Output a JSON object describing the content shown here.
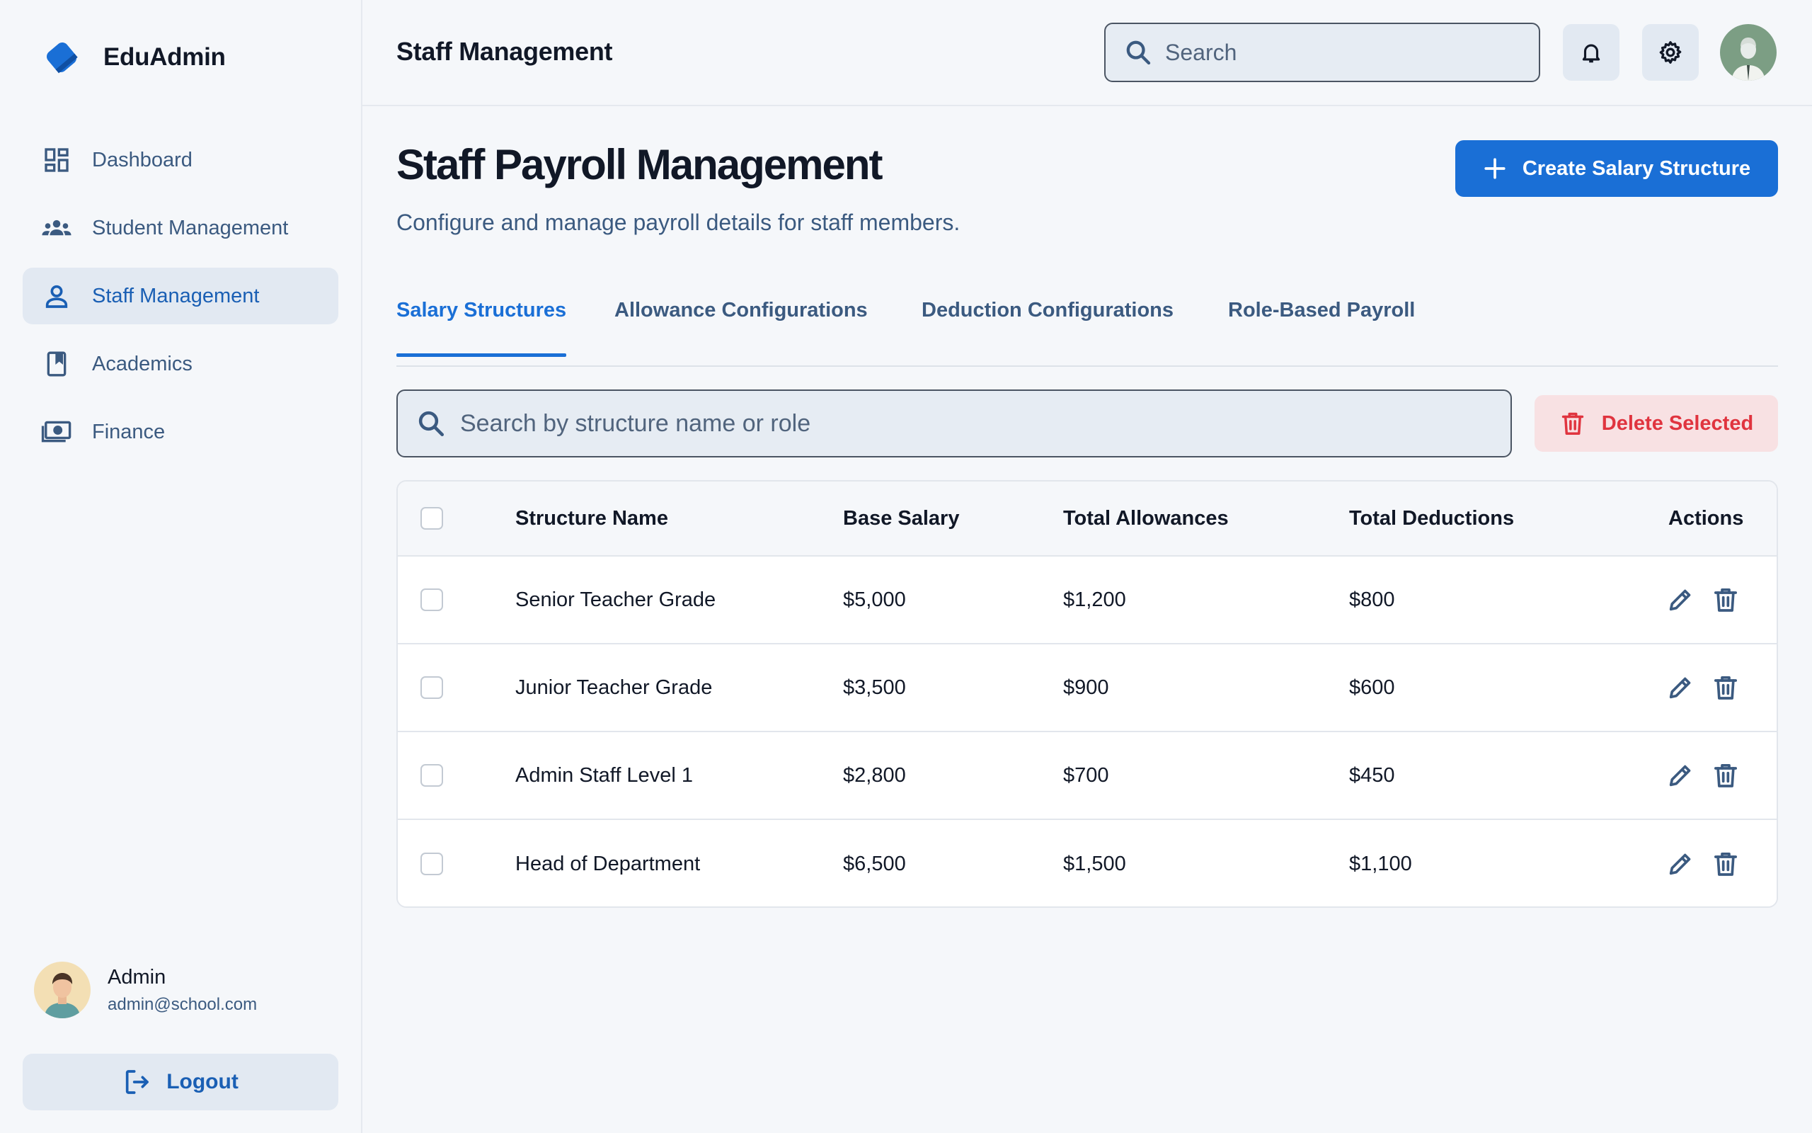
{
  "brand": {
    "name": "EduAdmin"
  },
  "sidebar": {
    "items": [
      {
        "label": "Dashboard",
        "icon": "dashboard-icon",
        "active": false
      },
      {
        "label": "Student Management",
        "icon": "group-icon",
        "active": false
      },
      {
        "label": "Staff Management",
        "icon": "person-icon",
        "active": true
      },
      {
        "label": "Academics",
        "icon": "book-icon",
        "active": false
      },
      {
        "label": "Finance",
        "icon": "money-icon",
        "active": false
      }
    ],
    "user": {
      "name": "Admin",
      "email": "admin@school.com"
    },
    "logout_label": "Logout"
  },
  "header": {
    "title": "Staff Management",
    "search_placeholder": "Search"
  },
  "main": {
    "title": "Staff Payroll Management",
    "subtitle": "Configure and manage payroll details for staff members.",
    "create_button": "Create Salary Structure",
    "tabs": [
      {
        "label": "Salary Structures",
        "active": true
      },
      {
        "label": "Allowance Configurations",
        "active": false
      },
      {
        "label": "Deduction Configurations",
        "active": false
      },
      {
        "label": "Role-Based Payroll",
        "active": false
      }
    ],
    "filter_placeholder": "Search by structure name or role",
    "delete_button": "Delete Selected"
  },
  "table": {
    "columns": [
      "Structure Name",
      "Base Salary",
      "Total Allowances",
      "Total Deductions",
      "Actions"
    ],
    "rows": [
      {
        "name": "Senior Teacher Grade",
        "base": "$5,000",
        "allowances": "$1,200",
        "deductions": "$800"
      },
      {
        "name": "Junior Teacher Grade",
        "base": "$3,500",
        "allowances": "$900",
        "deductions": "$600"
      },
      {
        "name": "Admin Staff Level 1",
        "base": "$2,800",
        "allowances": "$700",
        "deductions": "$450"
      },
      {
        "name": "Head of Department",
        "base": "$6,500",
        "allowances": "$1,500",
        "deductions": "$1,100"
      }
    ]
  },
  "colors": {
    "primary": "#1a6fd6",
    "nav_text": "#3b5a80",
    "danger": "#e0343f",
    "danger_bg": "#f8e1e3",
    "active_bg": "#e2e9f2"
  }
}
